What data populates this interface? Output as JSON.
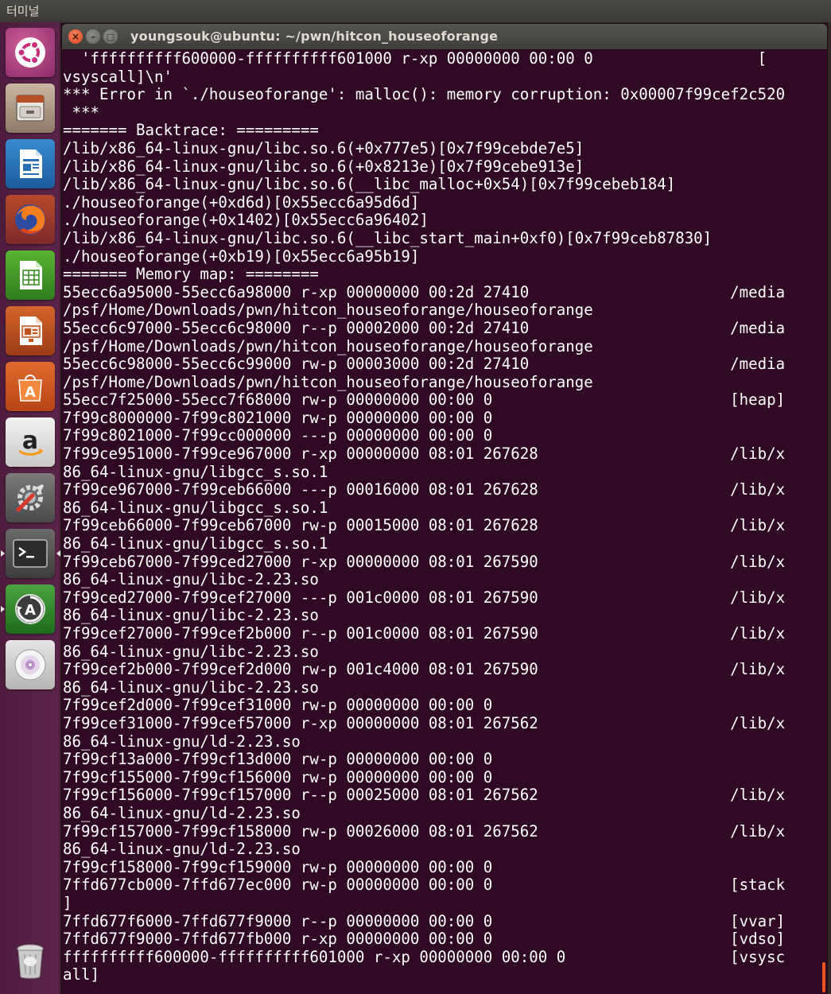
{
  "top_panel": {
    "app_name": "터미널"
  },
  "launcher": {
    "items": [
      {
        "name": "dash",
        "icon": "ubuntu-logo-icon"
      },
      {
        "name": "files",
        "icon": "file-cabinet-icon"
      },
      {
        "name": "writer",
        "icon": "document-icon"
      },
      {
        "name": "firefox",
        "icon": "firefox-icon"
      },
      {
        "name": "calc",
        "icon": "spreadsheet-icon"
      },
      {
        "name": "impress",
        "icon": "presentation-icon"
      },
      {
        "name": "software",
        "icon": "shopping-bag-icon"
      },
      {
        "name": "amazon",
        "icon": "amazon-icon"
      },
      {
        "name": "settings",
        "icon": "settings-tools-icon"
      },
      {
        "name": "terminal",
        "icon": "terminal-icon"
      },
      {
        "name": "updater",
        "icon": "software-updater-icon"
      },
      {
        "name": "dvd",
        "icon": "disc-icon"
      },
      {
        "name": "trash",
        "icon": "trash-icon"
      }
    ]
  },
  "window": {
    "title": "youngsouk@ubuntu: ~/pwn/hitcon_houseoforange",
    "close_symbol": "×",
    "minimize_symbol": "–",
    "maximize_symbol": "□"
  },
  "terminal": {
    "lines": [
      "  'ffffffffff600000-ffffffffff601000 r-xp 00000000 00:00 0                  [",
      "vsyscall]\\n'",
      "*** Error in `./houseoforange': malloc(): memory corruption: 0x00007f99cef2c520",
      " ***",
      "======= Backtrace: =========",
      "/lib/x86_64-linux-gnu/libc.so.6(+0x777e5)[0x7f99cebde7e5]",
      "/lib/x86_64-linux-gnu/libc.so.6(+0x8213e)[0x7f99cebe913e]",
      "/lib/x86_64-linux-gnu/libc.so.6(__libc_malloc+0x54)[0x7f99cebeb184]",
      "./houseoforange(+0xd6d)[0x55ecc6a95d6d]",
      "./houseoforange(+0x1402)[0x55ecc6a96402]",
      "/lib/x86_64-linux-gnu/libc.so.6(__libc_start_main+0xf0)[0x7f99ceb87830]",
      "./houseoforange(+0xb19)[0x55ecc6a95b19]",
      "======= Memory map: ========",
      "55ecc6a95000-55ecc6a98000 r-xp 00000000 00:2d 27410                      /media",
      "/psf/Home/Downloads/pwn/hitcon_houseoforange/houseoforange",
      "55ecc6c97000-55ecc6c98000 r--p 00002000 00:2d 27410                      /media",
      "/psf/Home/Downloads/pwn/hitcon_houseoforange/houseoforange",
      "55ecc6c98000-55ecc6c99000 rw-p 00003000 00:2d 27410                      /media",
      "/psf/Home/Downloads/pwn/hitcon_houseoforange/houseoforange",
      "55ecc7f25000-55ecc7f68000 rw-p 00000000 00:00 0                          [heap]",
      "7f99c8000000-7f99c8021000 rw-p 00000000 00:00 0",
      "7f99c8021000-7f99cc000000 ---p 00000000 00:00 0",
      "7f99ce951000-7f99ce967000 r-xp 00000000 08:01 267628                     /lib/x",
      "86_64-linux-gnu/libgcc_s.so.1",
      "7f99ce967000-7f99ceb66000 ---p 00016000 08:01 267628                     /lib/x",
      "86_64-linux-gnu/libgcc_s.so.1",
      "7f99ceb66000-7f99ceb67000 rw-p 00015000 08:01 267628                     /lib/x",
      "86_64-linux-gnu/libgcc_s.so.1",
      "7f99ceb67000-7f99ced27000 r-xp 00000000 08:01 267590                     /lib/x",
      "86_64-linux-gnu/libc-2.23.so",
      "7f99ced27000-7f99cef27000 ---p 001c0000 08:01 267590                     /lib/x",
      "86_64-linux-gnu/libc-2.23.so",
      "7f99cef27000-7f99cef2b000 r--p 001c0000 08:01 267590                     /lib/x",
      "86_64-linux-gnu/libc-2.23.so",
      "7f99cef2b000-7f99cef2d000 rw-p 001c4000 08:01 267590                     /lib/x",
      "86_64-linux-gnu/libc-2.23.so",
      "7f99cef2d000-7f99cef31000 rw-p 00000000 00:00 0",
      "7f99cef31000-7f99cef57000 r-xp 00000000 08:01 267562                     /lib/x",
      "86_64-linux-gnu/ld-2.23.so",
      "7f99cf13a000-7f99cf13d000 rw-p 00000000 00:00 0",
      "7f99cf155000-7f99cf156000 rw-p 00000000 00:00 0",
      "7f99cf156000-7f99cf157000 r--p 00025000 08:01 267562                     /lib/x",
      "86_64-linux-gnu/ld-2.23.so",
      "7f99cf157000-7f99cf158000 rw-p 00026000 08:01 267562                     /lib/x",
      "86_64-linux-gnu/ld-2.23.so",
      "7f99cf158000-7f99cf159000 rw-p 00000000 00:00 0",
      "7ffd677cb000-7ffd677ec000 rw-p 00000000 00:00 0                          [stack",
      "]",
      "7ffd677f6000-7ffd677f9000 r--p 00000000 00:00 0                          [vvar]",
      "7ffd677f9000-7ffd677fb000 r-xp 00000000 00:00 0                          [vdso]",
      "ffffffffff600000-ffffffffff601000 r-xp 00000000 00:00 0                  [vsysc",
      "all]"
    ]
  },
  "colors": {
    "terminal_bg": "#300a24",
    "terminal_fg": "#ffffff",
    "launcher_bg": "#4e1d3e",
    "accent": "#e95420"
  }
}
